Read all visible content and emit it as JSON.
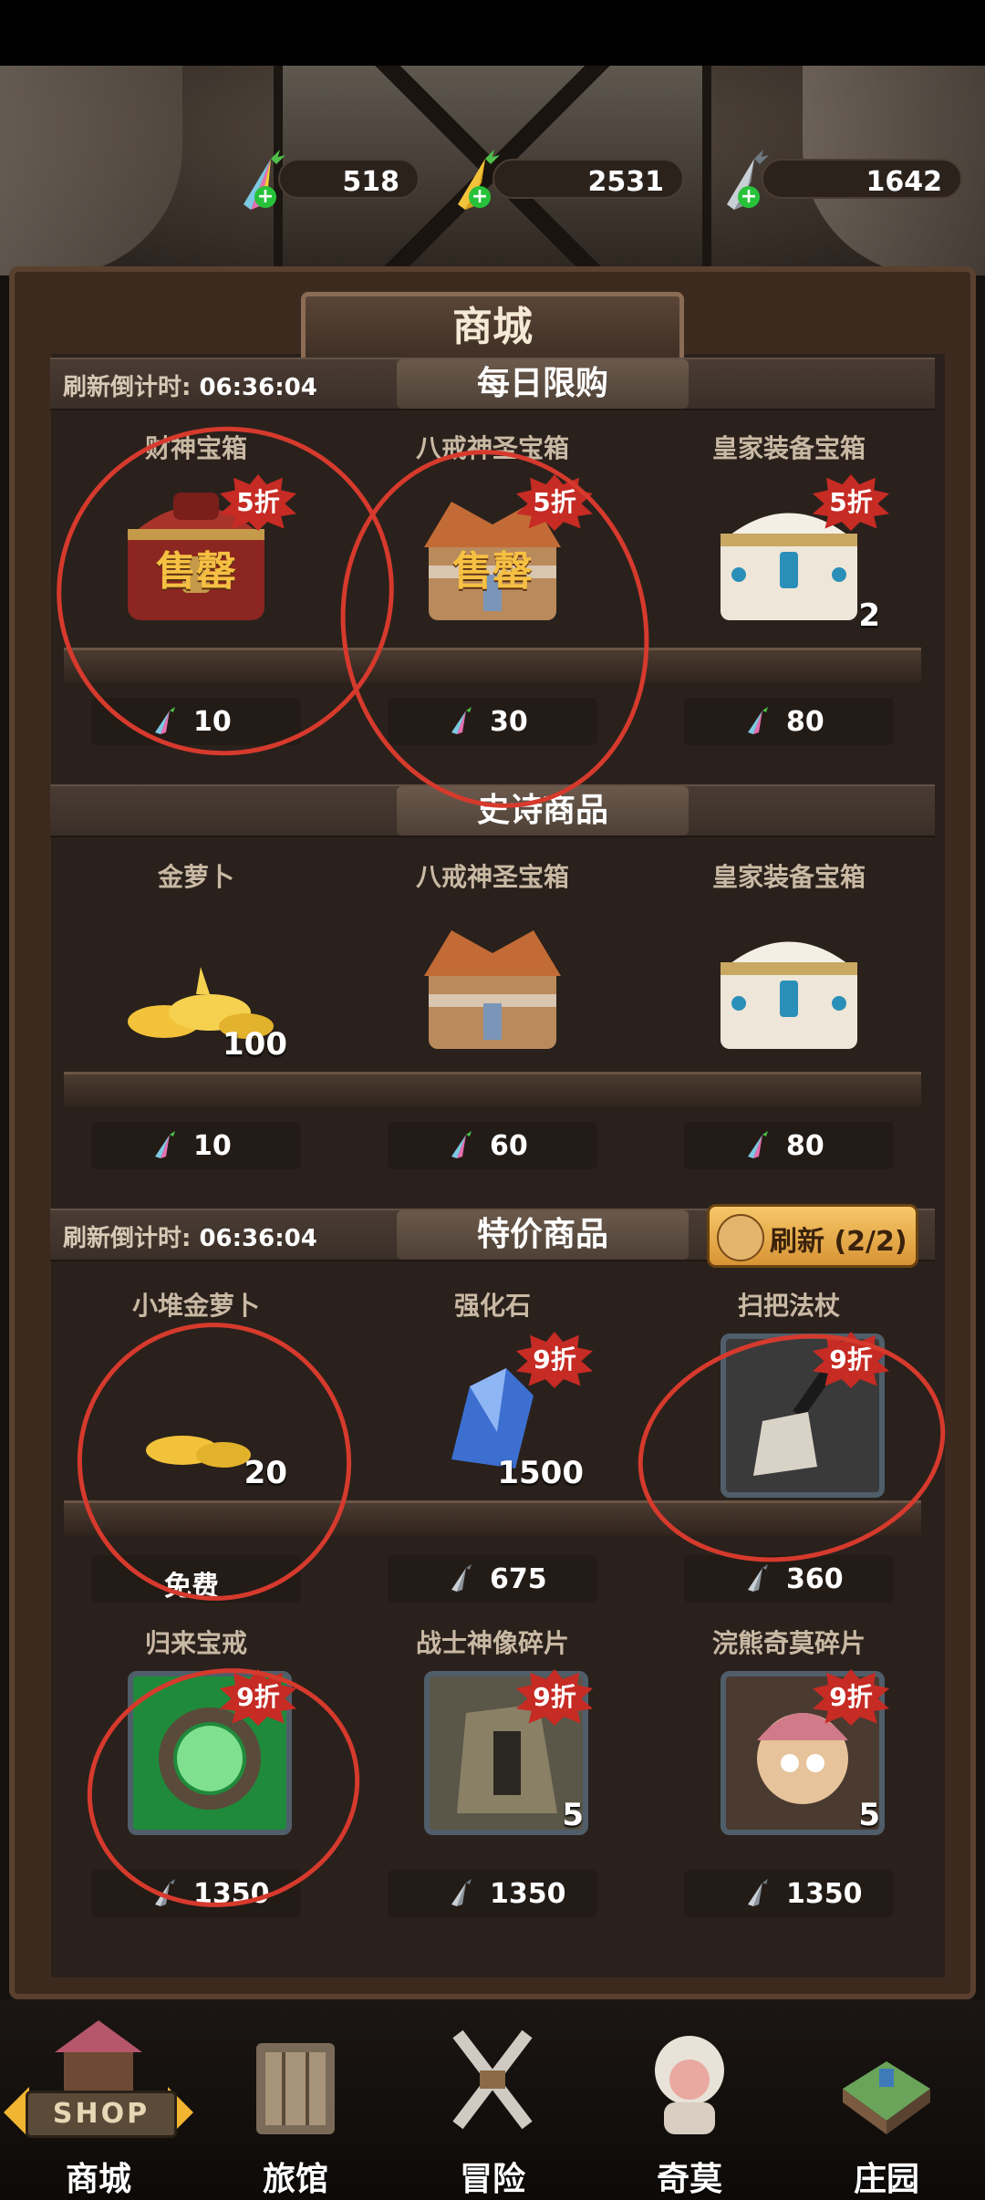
{
  "currencies": [
    {
      "name": "rainbow-carrot",
      "value": "518",
      "color": "#8d6cf0"
    },
    {
      "name": "gold-carrot",
      "value": "2531",
      "color": "#f2c33a"
    },
    {
      "name": "silver-carrot",
      "value": "1642",
      "color": "#a9b2ba"
    }
  ],
  "page_title": "商城",
  "daily": {
    "title": "每日限购",
    "countdown_label": "刷新倒计时:",
    "countdown": "06:36:04",
    "items": [
      {
        "name": "财神宝箱",
        "badge": "5折",
        "status": "售罄",
        "price": "10",
        "currency": "rainbow-carrot-icon"
      },
      {
        "name": "八戒神圣宝箱",
        "badge": "5折",
        "status": "售罄",
        "price": "30",
        "currency": "rainbow-carrot-icon"
      },
      {
        "name": "皇家装备宝箱",
        "badge": "5折",
        "qty": "2",
        "price": "80",
        "currency": "rainbow-carrot-icon"
      }
    ]
  },
  "epic": {
    "title": "史诗商品",
    "items": [
      {
        "name": "金萝卜",
        "qty": "100",
        "price": "10",
        "currency": "rainbow-carrot-icon"
      },
      {
        "name": "八戒神圣宝箱",
        "price": "60",
        "currency": "rainbow-carrot-icon"
      },
      {
        "name": "皇家装备宝箱",
        "price": "80",
        "currency": "rainbow-carrot-icon"
      }
    ]
  },
  "special": {
    "title": "特价商品",
    "countdown_label": "刷新倒计时:",
    "countdown": "06:36:04",
    "refresh_label": "刷新 (2/2)",
    "row1": [
      {
        "name": "小堆金萝卜",
        "qty": "20",
        "price": "免费"
      },
      {
        "name": "强化石",
        "badge": "9折",
        "qty": "1500",
        "price": "675",
        "currency": "silver-carrot-icon"
      },
      {
        "name": "扫把法杖",
        "badge": "9折",
        "price": "360",
        "currency": "silver-carrot-icon"
      }
    ],
    "row2": [
      {
        "name": "归来宝戒",
        "badge": "9折",
        "price": "1350",
        "currency": "silver-carrot-icon"
      },
      {
        "name": "战士神像碎片",
        "badge": "9折",
        "qty": "5",
        "price": "1350",
        "currency": "silver-carrot-icon"
      },
      {
        "name": "浣熊奇莫碎片",
        "badge": "9折",
        "qty": "5",
        "price": "1350",
        "currency": "silver-carrot-icon"
      }
    ]
  },
  "nav": [
    {
      "label": "商城",
      "sign": "SHOP",
      "icon": "shop-stall-icon"
    },
    {
      "label": "旅馆",
      "icon": "inn-gate-icon"
    },
    {
      "label": "冒险",
      "icon": "crossed-swords-icon"
    },
    {
      "label": "奇莫",
      "icon": "pet-character-icon"
    },
    {
      "label": "庄园",
      "icon": "manor-island-icon"
    }
  ]
}
